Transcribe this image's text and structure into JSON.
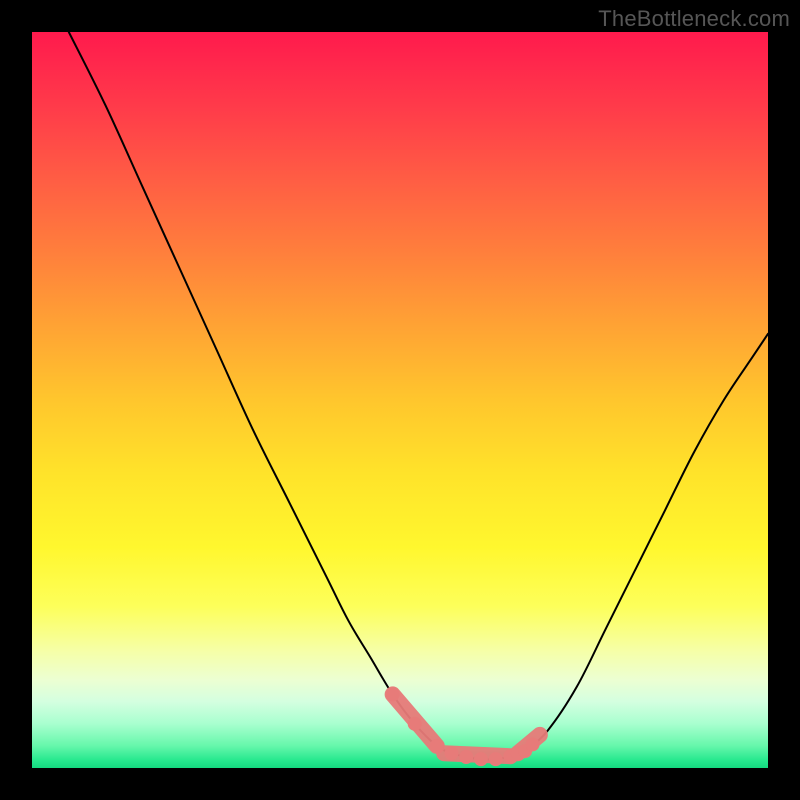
{
  "attribution": {
    "text": "TheBottleneck.com"
  },
  "colors": {
    "page_bg": "#000000",
    "curve_stroke": "#000000",
    "marker_fill": "#e77b79",
    "marker_stroke": "#b75553",
    "gradient_stops": [
      "#ff1a4d",
      "#ff3a4a",
      "#ff5d44",
      "#ff7f3c",
      "#ffa334",
      "#ffc62d",
      "#ffe32a",
      "#fff72e",
      "#fdff5a",
      "#f6ffa6",
      "#ecffd2",
      "#d4ffe0",
      "#a8ffcf",
      "#66f7ab",
      "#25e88d",
      "#14d97f"
    ]
  },
  "chart_data": {
    "type": "line",
    "title": "",
    "xlabel": "",
    "ylabel": "",
    "xlim": [
      0,
      100
    ],
    "ylim": [
      0,
      100
    ],
    "grid": false,
    "legend": null,
    "series": [
      {
        "name": "left-branch",
        "x": [
          5,
          10,
          15,
          20,
          25,
          30,
          35,
          40,
          43,
          46,
          49,
          52,
          55,
          57
        ],
        "values": [
          100,
          90,
          79,
          68,
          57,
          46,
          36,
          26,
          20,
          15,
          10,
          6,
          3,
          2
        ]
      },
      {
        "name": "valley-floor",
        "x": [
          57,
          59,
          61,
          63,
          65,
          67
        ],
        "values": [
          2,
          1.5,
          1.2,
          1.2,
          1.6,
          2.3
        ]
      },
      {
        "name": "right-branch",
        "x": [
          67,
          70,
          74,
          78,
          82,
          86,
          90,
          94,
          98,
          100
        ],
        "values": [
          2.3,
          5,
          11,
          19,
          27,
          35,
          43,
          50,
          56,
          59
        ]
      }
    ],
    "markers": [
      {
        "series": "low-markers",
        "shape": "circle",
        "x": [
          49,
          52,
          55,
          57,
          59,
          61,
          63,
          65,
          66,
          67,
          68
        ],
        "values": [
          10,
          6,
          3,
          2,
          1.5,
          1.2,
          1.2,
          1.6,
          2.0,
          2.3,
          3.2
        ]
      }
    ],
    "marker_capsules": [
      {
        "name": "left-cap",
        "x1": 49,
        "y1": 10,
        "x2": 55,
        "y2": 3
      },
      {
        "name": "floor-cap",
        "x1": 56,
        "y1": 2,
        "x2": 65,
        "y2": 1.6
      },
      {
        "name": "right-cap",
        "x1": 66,
        "y1": 2.0,
        "x2": 69,
        "y2": 4.5
      }
    ]
  }
}
